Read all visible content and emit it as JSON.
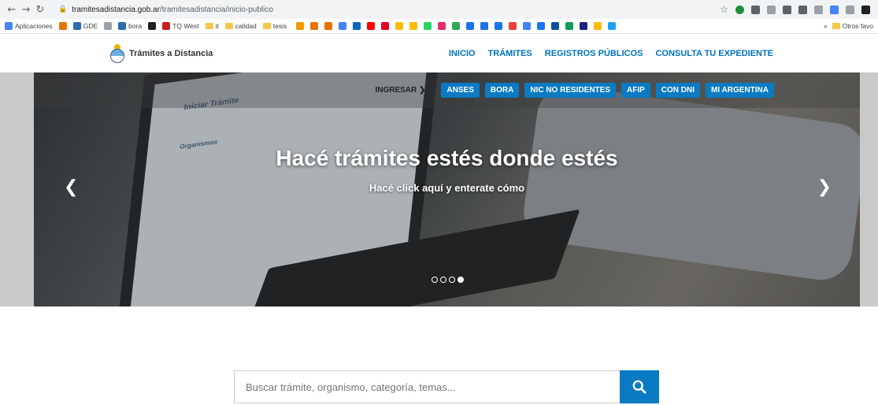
{
  "browser": {
    "url_host": "tramitesadistancia.gob.ar",
    "url_path": "/tramitesadistancia/inicio-publico",
    "extension_colors": [
      "#1e8e3e",
      "#5f6368",
      "#9aa0a6",
      "#5f6368",
      "#5f6368",
      "#9aa0a6",
      "#4285f4",
      "#9aa0a6",
      "#202124"
    ]
  },
  "bookmarks": {
    "items": [
      {
        "label": "Aplicaciones",
        "color": "#4285f4"
      },
      {
        "label": "",
        "color": "#e37400"
      },
      {
        "label": "GDE",
        "color": "#2b6cb0"
      },
      {
        "label": "",
        "color": "#9aa0a6"
      },
      {
        "label": "bora",
        "color": "#2b6cb0"
      },
      {
        "label": "",
        "color": "#202124"
      },
      {
        "label": "TQ West",
        "color": "#c5221f"
      },
      {
        "label": "it",
        "color": "#f2c94c"
      },
      {
        "label": "calidad",
        "color": "#f2c94c"
      },
      {
        "label": "tesis",
        "color": "#f2c94c"
      }
    ],
    "icon_colors": [
      "#f29900",
      "#e8710a",
      "#e37400",
      "#4285f4",
      "#0a66c2",
      "#ff0000",
      "#e60023",
      "#fbbc04",
      "#fbbc04",
      "#25d366",
      "#e1306c",
      "#34a853",
      "#1a73e8",
      "#1a73e8",
      "#1a73e8",
      "#ea4335",
      "#4285f4",
      "#1877f2",
      "#0b5394",
      "#0f9d58",
      "#1a237e",
      "#fbbc04",
      "#1da1f2"
    ],
    "more_label": "»",
    "other_label": "Otros favo"
  },
  "site": {
    "logo_text": "Trámites a Distancia",
    "nav": [
      "INICIO",
      "TRÁMITES",
      "REGISTROS PÚBLICOS",
      "CONSULTA TU EXPEDIENTE"
    ]
  },
  "hero": {
    "ingresar": "INGRESAR ❯",
    "quick_links": [
      "ANSES",
      "BORA",
      "NIC NO RESIDENTES",
      "AFIP",
      "CON DNI",
      "MI ARGENTINA"
    ],
    "title": "Hacé trámites estés donde estés",
    "subtitle": "Hacé click aquí y enterate cómo",
    "laptop_heading": "Iniciar Trámite",
    "laptop_side": "Organismos",
    "slide_count": 4,
    "active_slide": 4
  },
  "search": {
    "placeholder": "Buscar trámite, organismo, categoría, temas..."
  }
}
